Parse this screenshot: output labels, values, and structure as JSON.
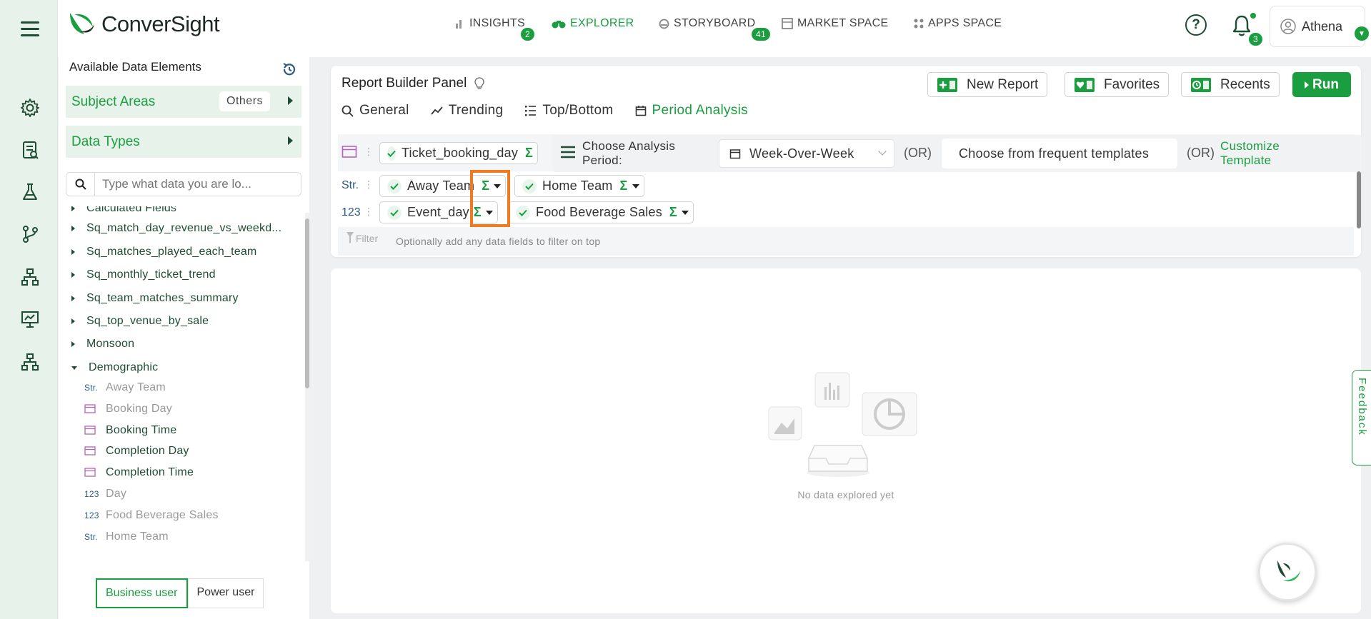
{
  "app": {
    "brand": "ConverSight",
    "accent": "#1a9e3f"
  },
  "nav": [
    {
      "label": "INSIGHTS",
      "badge": "2"
    },
    {
      "label": "EXPLORER",
      "badge": ""
    },
    {
      "label": "STORYBOARD",
      "badge": "41"
    },
    {
      "label": "MARKET SPACE",
      "badge": ""
    },
    {
      "label": "APPS SPACE",
      "badge": ""
    }
  ],
  "notifications": {
    "count": "3"
  },
  "user": {
    "name": "Athena"
  },
  "left_panel": {
    "title": "Available Data Elements",
    "subject_areas": {
      "label": "Subject Areas",
      "tag": "Others"
    },
    "data_types": {
      "label": "Data Types"
    },
    "search_placeholder": "Type what data you are lo...",
    "tree": [
      "Calculated Fields",
      "Sq_match_day_revenue_vs_weekd...",
      "Sq_matches_played_each_team",
      "Sq_monthly_ticket_trend",
      "Sq_team_matches_summary",
      "Sq_top_venue_by_sale",
      "Monsoon",
      "Demographic"
    ],
    "fields": [
      {
        "type": "Str.",
        "label": "Away Team"
      },
      {
        "type": "cal",
        "label": "Booking Day"
      },
      {
        "type": "cal",
        "label": "Booking Time"
      },
      {
        "type": "cal",
        "label": "Completion Day"
      },
      {
        "type": "cal",
        "label": "Completion Time"
      },
      {
        "type": "123",
        "label": "Day"
      },
      {
        "type": "123",
        "label": "Food Beverage Sales"
      },
      {
        "type": "Str.",
        "label": "Home Team"
      }
    ],
    "user_modes": [
      "Business user",
      "Power user"
    ]
  },
  "report_builder": {
    "title": "Report Builder Panel",
    "buttons": {
      "new_report": "New Report",
      "favorites": "Favorites",
      "recents": "Recents",
      "run": "Run"
    },
    "tabs": [
      "General",
      "Trending",
      "Top/Bottom",
      "Period Analysis"
    ],
    "active_tab": "Period Analysis",
    "date_chip": "Ticket_booking_day",
    "analysis_label": "Choose Analysis Period:",
    "analysis_value": "Week-Over-Week",
    "or_label": "(OR)",
    "template_placeholder": "Choose from frequent templates",
    "customize_link": "Customize Template",
    "str_label": "Str.",
    "num_label": "123",
    "str_chips": [
      "Away Team",
      "Home Team"
    ],
    "num_chips": [
      "Event_day",
      "Food Beverage Sales"
    ],
    "sigma": "Σ",
    "filter_label": "Filter",
    "filter_hint": "Optionally add any data fields to filter on top"
  },
  "empty_state": {
    "message": "No data explored yet"
  },
  "feedback": {
    "label": "Feedback"
  }
}
